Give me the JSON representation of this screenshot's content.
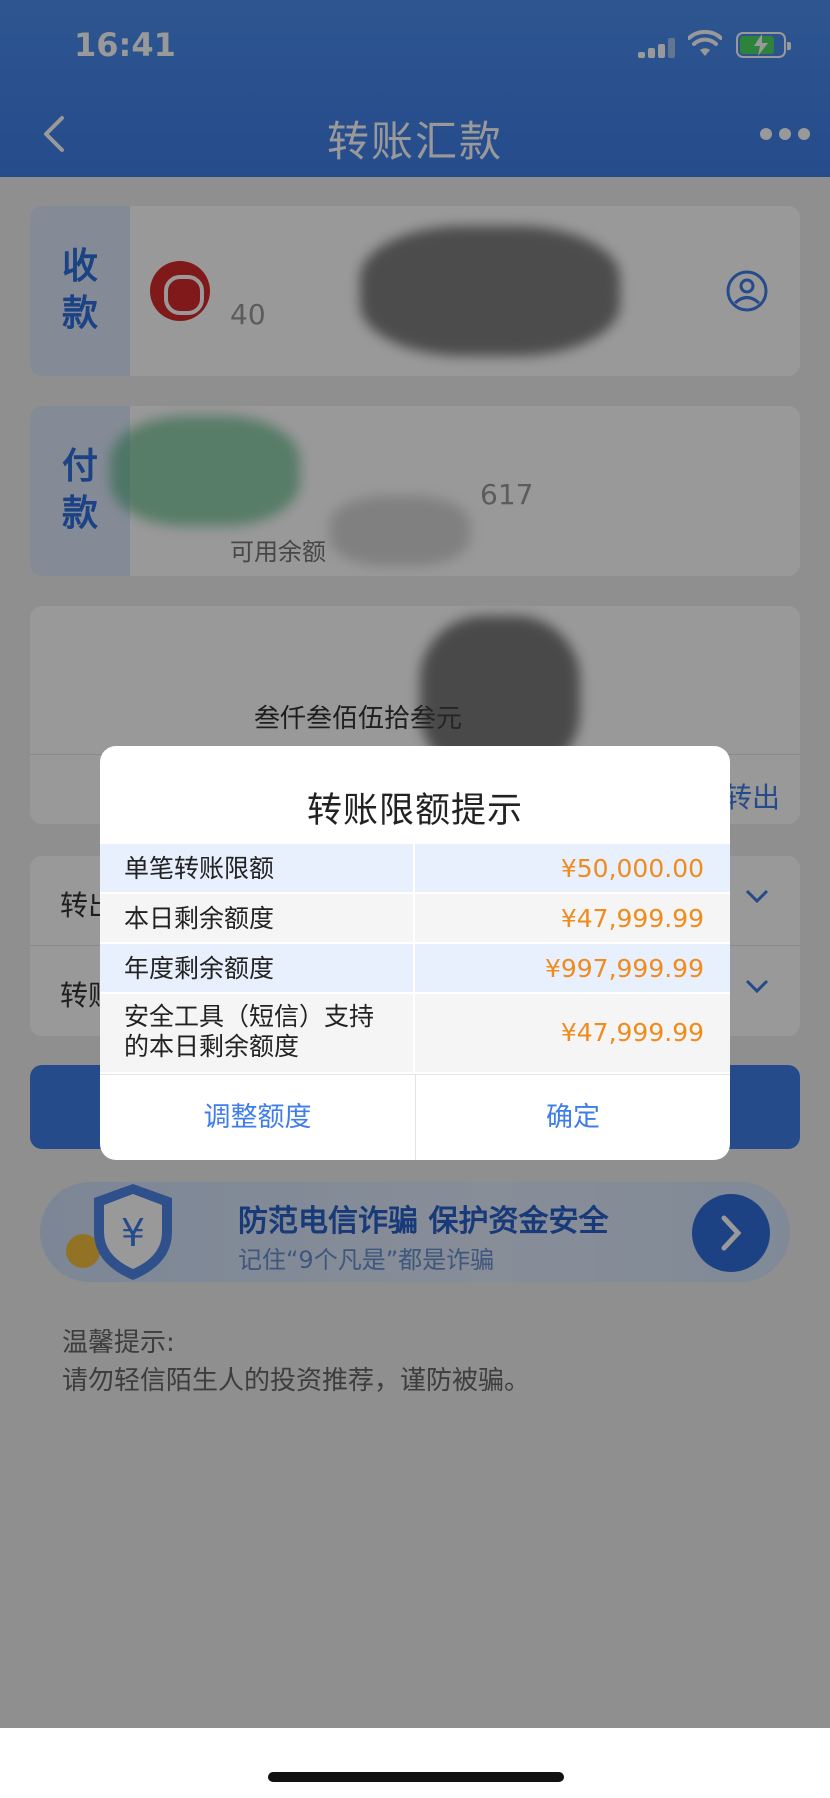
{
  "status_bar": {
    "time": "16:41"
  },
  "header": {
    "title": "转账汇款",
    "back_icon": "chevron-left-icon",
    "more_icon": "more-dots-icon"
  },
  "payee_card": {
    "tag_line1": "收",
    "tag_line2": "款",
    "account_partial": "40"
  },
  "payer_card": {
    "tag_line1": "付",
    "tag_line2": "款",
    "account_partial": "617",
    "balance_label": "可用余额"
  },
  "amount_card": {
    "amount_in_words": "叁仟叁佰伍拾叁元",
    "transfer_out_partial": "转出"
  },
  "fields": [
    {
      "label": "转出"
    },
    {
      "label": "转账"
    }
  ],
  "banner": {
    "title": "防范电信诈骗  保护资金安全",
    "subtitle": "记住“9个凡是”都是诈骗",
    "currency_glyph": "¥"
  },
  "tips": {
    "heading": "温馨提示:",
    "body": "请勿轻信陌生人的投资推荐，谨防被骗。"
  },
  "modal": {
    "title": "转账限额提示",
    "rows": [
      {
        "label": "单笔转账限额",
        "value": "¥50,000.00"
      },
      {
        "label": "本日剩余额度",
        "value": "¥47,999.99"
      },
      {
        "label": "年度剩余额度",
        "value": "¥997,999.99"
      },
      {
        "label_line1": "安全工具（短信）支持",
        "label_line2": "的本日剩余额度",
        "value": "¥47,999.99"
      }
    ],
    "adjust_label": "调整额度",
    "confirm_label": "确定"
  },
  "colors": {
    "brand_blue": "#3f7ee8",
    "amount_orange": "#f08b1d",
    "bank_red": "#d52b2b"
  }
}
